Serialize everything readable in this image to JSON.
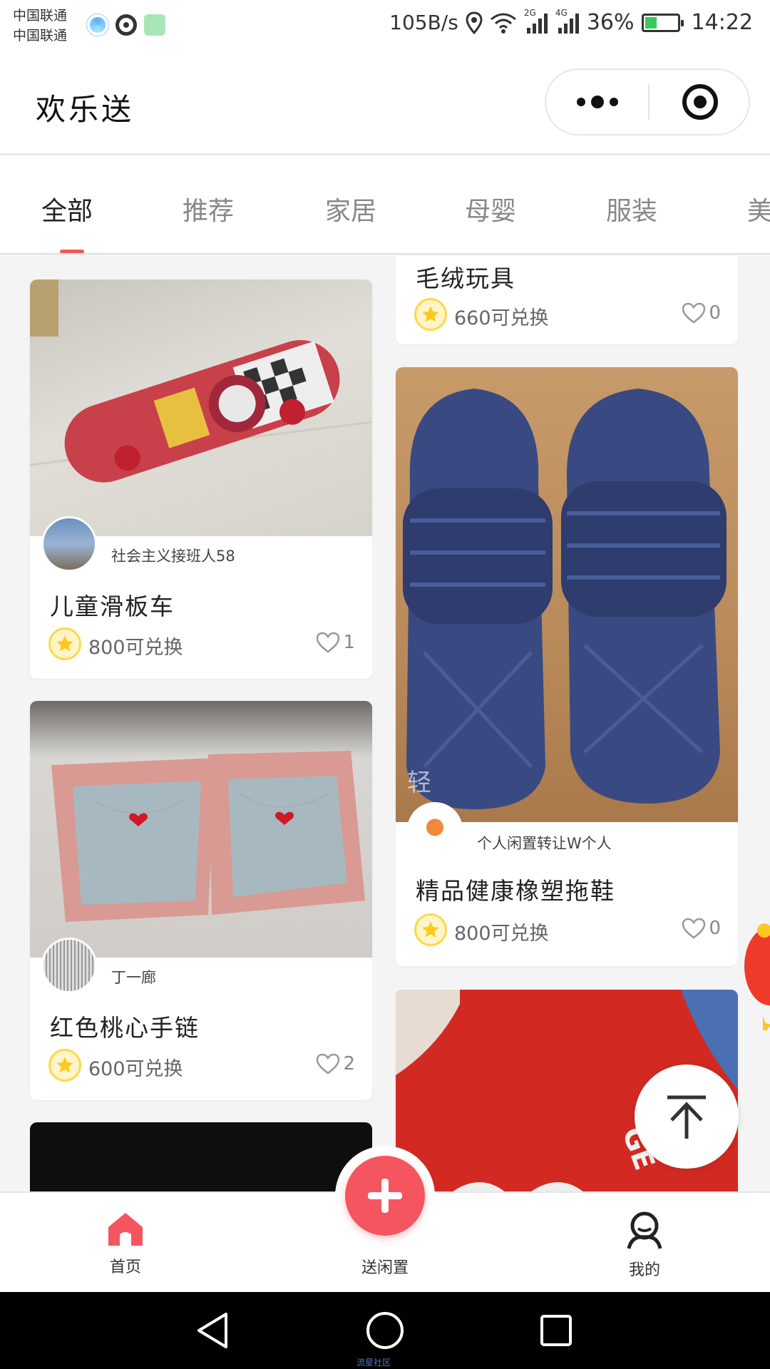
{
  "status_bar": {
    "carrier_1": "中国联通",
    "carrier_2": "中国联通",
    "net_speed": "105B/s",
    "signal_1": "2G",
    "signal_2": "4G",
    "battery": "36%",
    "battery_level": 0.36,
    "time": "14:22"
  },
  "header": {
    "title": "欢乐送",
    "more_icon": "more-dots-icon",
    "close_icon": "target-close-icon"
  },
  "tabs": [
    {
      "label": "全部",
      "active": true
    },
    {
      "label": "推荐",
      "active": false
    },
    {
      "label": "家居",
      "active": false
    },
    {
      "label": "母婴",
      "active": false
    },
    {
      "label": "服装",
      "active": false
    },
    {
      "label": "美",
      "active": false
    }
  ],
  "feed": {
    "left": [
      {
        "username": "社会主义接班人58",
        "title": "儿童滑板车",
        "price": "800可兑换",
        "likes": "1"
      },
      {
        "username": "丁一廊",
        "title": "红色桃心手链",
        "price": "600可兑换",
        "likes": "2"
      }
    ],
    "right": [
      {
        "title": "毛绒玩具",
        "price": "660可兑换",
        "likes": "0"
      },
      {
        "username": "个人闲置转让W个人",
        "title": "精品健康橡塑拖鞋",
        "price": "800可兑换",
        "likes": "0",
        "image_text": "轻"
      }
    ],
    "right_card3": {
      "image_text": "GE"
    }
  },
  "bottom_nav": {
    "home": "首页",
    "post": "送闲置",
    "mine": "我的"
  },
  "colors": {
    "accent": "#f5555e",
    "tab_indicator": "#f05a5a",
    "star": "#ffd84a"
  },
  "watermark": "流星社区"
}
